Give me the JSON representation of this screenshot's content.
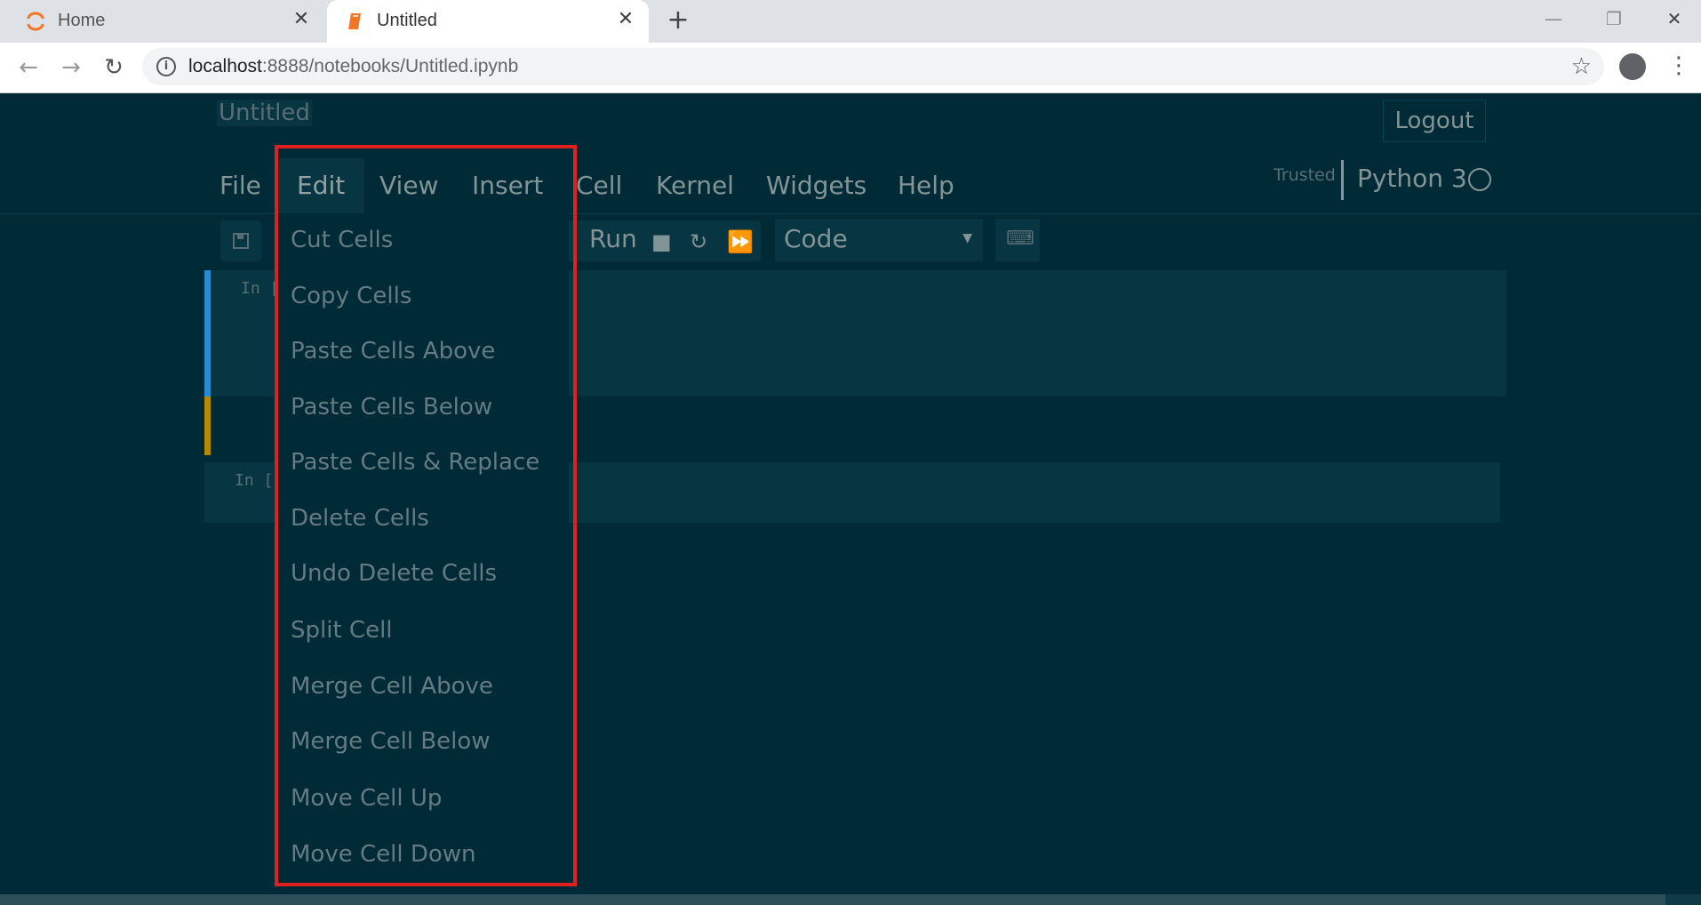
{
  "browser": {
    "tabs": [
      {
        "title": "Home",
        "active": false
      },
      {
        "title": "Untitled",
        "active": true
      }
    ],
    "new_tab": "+",
    "url_host": "localhost",
    "url_rest": ":8888/notebooks/Untitled.ipynb"
  },
  "notebook": {
    "title": "Untitled",
    "logout_label": "Logout",
    "menus": [
      "File",
      "Edit",
      "View",
      "Insert",
      "Cell",
      "Kernel",
      "Widgets",
      "Help"
    ],
    "trusted_label": "Trusted",
    "kernel_name": "Python 3",
    "run_label": "Run",
    "cell_type": "Code",
    "cells": [
      {
        "prompt": "In ["
      },
      {
        "prompt": "In ["
      }
    ]
  },
  "edit_menu": {
    "items": [
      "Cut Cells",
      "Copy Cells",
      "Paste Cells Above",
      "Paste Cells Below",
      "Paste Cells & Replace",
      "Delete Cells",
      "Undo Delete Cells",
      "Split Cell",
      "Merge Cell Above",
      "Merge Cell Below",
      "Move Cell Up",
      "Move Cell Down"
    ]
  },
  "colors": {
    "background": "#002b36",
    "panel": "#073642",
    "text": "#839496",
    "highlight_border": "#e02020",
    "selected_cell_bar": "#268bd2",
    "markdown_cell_bar": "#b58900"
  }
}
